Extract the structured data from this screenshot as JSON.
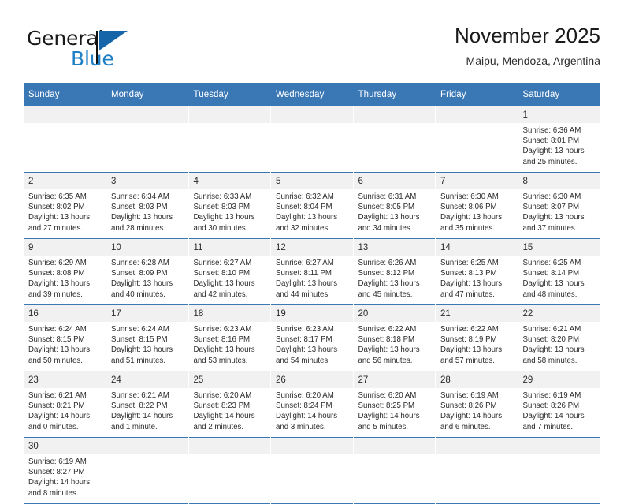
{
  "brand": {
    "name_top": "General",
    "name_bottom": "Blue",
    "flag_icon": "triangle-flag-icon",
    "accent_color": "#1f7fc4",
    "header_color": "#3a77b5"
  },
  "header": {
    "title": "November 2025",
    "subtitle": "Maipu, Mendoza, Argentina"
  },
  "calendar": {
    "weekday_headers": [
      "Sunday",
      "Monday",
      "Tuesday",
      "Wednesday",
      "Thursday",
      "Friday",
      "Saturday"
    ],
    "weeks": [
      [
        {
          "day": "",
          "sunrise": "",
          "sunset": "",
          "daylight": "",
          "empty": true
        },
        {
          "day": "",
          "sunrise": "",
          "sunset": "",
          "daylight": "",
          "empty": true
        },
        {
          "day": "",
          "sunrise": "",
          "sunset": "",
          "daylight": "",
          "empty": true
        },
        {
          "day": "",
          "sunrise": "",
          "sunset": "",
          "daylight": "",
          "empty": true
        },
        {
          "day": "",
          "sunrise": "",
          "sunset": "",
          "daylight": "",
          "empty": true
        },
        {
          "day": "",
          "sunrise": "",
          "sunset": "",
          "daylight": "",
          "empty": true
        },
        {
          "day": "1",
          "sunrise": "Sunrise: 6:36 AM",
          "sunset": "Sunset: 8:01 PM",
          "daylight": "Daylight: 13 hours and 25 minutes.",
          "empty": false
        }
      ],
      [
        {
          "day": "2",
          "sunrise": "Sunrise: 6:35 AM",
          "sunset": "Sunset: 8:02 PM",
          "daylight": "Daylight: 13 hours and 27 minutes.",
          "empty": false
        },
        {
          "day": "3",
          "sunrise": "Sunrise: 6:34 AM",
          "sunset": "Sunset: 8:03 PM",
          "daylight": "Daylight: 13 hours and 28 minutes.",
          "empty": false
        },
        {
          "day": "4",
          "sunrise": "Sunrise: 6:33 AM",
          "sunset": "Sunset: 8:03 PM",
          "daylight": "Daylight: 13 hours and 30 minutes.",
          "empty": false
        },
        {
          "day": "5",
          "sunrise": "Sunrise: 6:32 AM",
          "sunset": "Sunset: 8:04 PM",
          "daylight": "Daylight: 13 hours and 32 minutes.",
          "empty": false
        },
        {
          "day": "6",
          "sunrise": "Sunrise: 6:31 AM",
          "sunset": "Sunset: 8:05 PM",
          "daylight": "Daylight: 13 hours and 34 minutes.",
          "empty": false
        },
        {
          "day": "7",
          "sunrise": "Sunrise: 6:30 AM",
          "sunset": "Sunset: 8:06 PM",
          "daylight": "Daylight: 13 hours and 35 minutes.",
          "empty": false
        },
        {
          "day": "8",
          "sunrise": "Sunrise: 6:30 AM",
          "sunset": "Sunset: 8:07 PM",
          "daylight": "Daylight: 13 hours and 37 minutes.",
          "empty": false
        }
      ],
      [
        {
          "day": "9",
          "sunrise": "Sunrise: 6:29 AM",
          "sunset": "Sunset: 8:08 PM",
          "daylight": "Daylight: 13 hours and 39 minutes.",
          "empty": false
        },
        {
          "day": "10",
          "sunrise": "Sunrise: 6:28 AM",
          "sunset": "Sunset: 8:09 PM",
          "daylight": "Daylight: 13 hours and 40 minutes.",
          "empty": false
        },
        {
          "day": "11",
          "sunrise": "Sunrise: 6:27 AM",
          "sunset": "Sunset: 8:10 PM",
          "daylight": "Daylight: 13 hours and 42 minutes.",
          "empty": false
        },
        {
          "day": "12",
          "sunrise": "Sunrise: 6:27 AM",
          "sunset": "Sunset: 8:11 PM",
          "daylight": "Daylight: 13 hours and 44 minutes.",
          "empty": false
        },
        {
          "day": "13",
          "sunrise": "Sunrise: 6:26 AM",
          "sunset": "Sunset: 8:12 PM",
          "daylight": "Daylight: 13 hours and 45 minutes.",
          "empty": false
        },
        {
          "day": "14",
          "sunrise": "Sunrise: 6:25 AM",
          "sunset": "Sunset: 8:13 PM",
          "daylight": "Daylight: 13 hours and 47 minutes.",
          "empty": false
        },
        {
          "day": "15",
          "sunrise": "Sunrise: 6:25 AM",
          "sunset": "Sunset: 8:14 PM",
          "daylight": "Daylight: 13 hours and 48 minutes.",
          "empty": false
        }
      ],
      [
        {
          "day": "16",
          "sunrise": "Sunrise: 6:24 AM",
          "sunset": "Sunset: 8:15 PM",
          "daylight": "Daylight: 13 hours and 50 minutes.",
          "empty": false
        },
        {
          "day": "17",
          "sunrise": "Sunrise: 6:24 AM",
          "sunset": "Sunset: 8:15 PM",
          "daylight": "Daylight: 13 hours and 51 minutes.",
          "empty": false
        },
        {
          "day": "18",
          "sunrise": "Sunrise: 6:23 AM",
          "sunset": "Sunset: 8:16 PM",
          "daylight": "Daylight: 13 hours and 53 minutes.",
          "empty": false
        },
        {
          "day": "19",
          "sunrise": "Sunrise: 6:23 AM",
          "sunset": "Sunset: 8:17 PM",
          "daylight": "Daylight: 13 hours and 54 minutes.",
          "empty": false
        },
        {
          "day": "20",
          "sunrise": "Sunrise: 6:22 AM",
          "sunset": "Sunset: 8:18 PM",
          "daylight": "Daylight: 13 hours and 56 minutes.",
          "empty": false
        },
        {
          "day": "21",
          "sunrise": "Sunrise: 6:22 AM",
          "sunset": "Sunset: 8:19 PM",
          "daylight": "Daylight: 13 hours and 57 minutes.",
          "empty": false
        },
        {
          "day": "22",
          "sunrise": "Sunrise: 6:21 AM",
          "sunset": "Sunset: 8:20 PM",
          "daylight": "Daylight: 13 hours and 58 minutes.",
          "empty": false
        }
      ],
      [
        {
          "day": "23",
          "sunrise": "Sunrise: 6:21 AM",
          "sunset": "Sunset: 8:21 PM",
          "daylight": "Daylight: 14 hours and 0 minutes.",
          "empty": false
        },
        {
          "day": "24",
          "sunrise": "Sunrise: 6:21 AM",
          "sunset": "Sunset: 8:22 PM",
          "daylight": "Daylight: 14 hours and 1 minute.",
          "empty": false
        },
        {
          "day": "25",
          "sunrise": "Sunrise: 6:20 AM",
          "sunset": "Sunset: 8:23 PM",
          "daylight": "Daylight: 14 hours and 2 minutes.",
          "empty": false
        },
        {
          "day": "26",
          "sunrise": "Sunrise: 6:20 AM",
          "sunset": "Sunset: 8:24 PM",
          "daylight": "Daylight: 14 hours and 3 minutes.",
          "empty": false
        },
        {
          "day": "27",
          "sunrise": "Sunrise: 6:20 AM",
          "sunset": "Sunset: 8:25 PM",
          "daylight": "Daylight: 14 hours and 5 minutes.",
          "empty": false
        },
        {
          "day": "28",
          "sunrise": "Sunrise: 6:19 AM",
          "sunset": "Sunset: 8:26 PM",
          "daylight": "Daylight: 14 hours and 6 minutes.",
          "empty": false
        },
        {
          "day": "29",
          "sunrise": "Sunrise: 6:19 AM",
          "sunset": "Sunset: 8:26 PM",
          "daylight": "Daylight: 14 hours and 7 minutes.",
          "empty": false
        }
      ],
      [
        {
          "day": "30",
          "sunrise": "Sunrise: 6:19 AM",
          "sunset": "Sunset: 8:27 PM",
          "daylight": "Daylight: 14 hours and 8 minutes.",
          "empty": false
        },
        {
          "day": "",
          "sunrise": "",
          "sunset": "",
          "daylight": "",
          "empty": true
        },
        {
          "day": "",
          "sunrise": "",
          "sunset": "",
          "daylight": "",
          "empty": true
        },
        {
          "day": "",
          "sunrise": "",
          "sunset": "",
          "daylight": "",
          "empty": true
        },
        {
          "day": "",
          "sunrise": "",
          "sunset": "",
          "daylight": "",
          "empty": true
        },
        {
          "day": "",
          "sunrise": "",
          "sunset": "",
          "daylight": "",
          "empty": true
        },
        {
          "day": "",
          "sunrise": "",
          "sunset": "",
          "daylight": "",
          "empty": true
        }
      ]
    ]
  }
}
